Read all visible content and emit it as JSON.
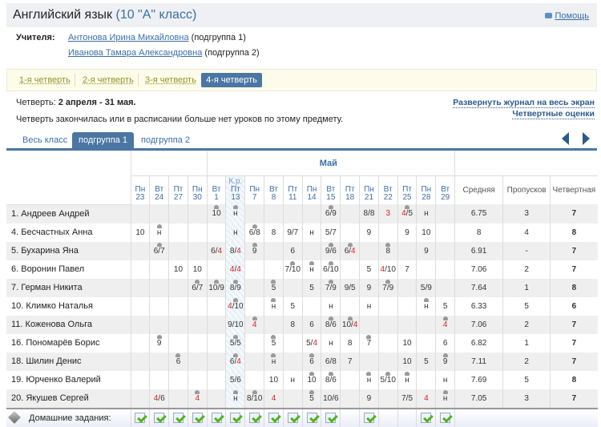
{
  "header": {
    "subject": "Английский язык",
    "class_label": "(10 \"А\" класс)",
    "help": "Помощь"
  },
  "teachers": {
    "label": "Учителя:",
    "list": [
      {
        "name": "Антонова Ирина Михайловна",
        "group": "(подгруппа 1)"
      },
      {
        "name": "Иванова Тамара Александровна",
        "group": "(подгруппа 2)"
      }
    ]
  },
  "quarters": [
    "1-я четверть",
    "2-я четверть",
    "3-я четверть",
    "4-я четверть"
  ],
  "period": {
    "label": "Четверть:",
    "value": "2 апреля - 31 мая.",
    "message": "Четверть закончилась или в расписании больше нет уроков по этому предмету."
  },
  "links": {
    "expand": "Развернуть журнал на весь экран",
    "quarter_marks": "Четвертные оценки"
  },
  "tabs": [
    "Весь класс",
    "подгруппа 1",
    "подгруппа 2"
  ],
  "journal": {
    "month": "Май",
    "days": [
      {
        "d": "Пн",
        "n": "23"
      },
      {
        "d": "Вт",
        "n": "24"
      },
      {
        "d": "Пт",
        "n": "27"
      },
      {
        "d": "Пн",
        "n": "30"
      },
      {
        "d": "Вт",
        "n": "1"
      },
      {
        "d": "Пт",
        "n": "13",
        "tag": "К.р."
      },
      {
        "d": "Пн",
        "n": "7"
      },
      {
        "d": "Вт",
        "n": "8"
      },
      {
        "d": "Пт",
        "n": "11"
      },
      {
        "d": "Пн",
        "n": "14"
      },
      {
        "d": "Вт",
        "n": "15"
      },
      {
        "d": "Пт",
        "n": "18"
      },
      {
        "d": "Пн",
        "n": "21"
      },
      {
        "d": "Вт",
        "n": "22"
      },
      {
        "d": "Пт",
        "n": "25"
      },
      {
        "d": "Пн",
        "n": "28"
      },
      {
        "d": "Вт",
        "n": "29"
      }
    ],
    "summary_headers": [
      "Средняя",
      "Пропусков",
      "Четвертная"
    ],
    "students": [
      {
        "name": "1. Андреев Андрей",
        "marks": [
          "",
          "",
          "",
          "",
          "10^",
          "н^",
          "",
          "",
          "",
          "",
          "6/9^",
          "",
          "8/8",
          "3",
          "4/5^",
          "н",
          ""
        ],
        "avg": "6.75",
        "absences": "3",
        "final": "7"
      },
      {
        "name": "4. Бесчастных Анна",
        "marks": [
          "10",
          "н^",
          "",
          "",
          "",
          "н",
          "6/8^",
          "8",
          "9/7",
          "н",
          "5/7",
          "",
          "9",
          "",
          "9",
          "10",
          ""
        ],
        "avg": "8",
        "absences": "4",
        "final": "8"
      },
      {
        "name": "5. Бухарина Яна",
        "marks": [
          "",
          "6/7^",
          "",
          "",
          "6/4",
          "8/4",
          "9^",
          "",
          "6",
          "",
          "9/6^",
          "6/4^",
          "",
          "8^",
          "",
          "9",
          ""
        ],
        "avg": "6.91",
        "absences": "-",
        "final": "7"
      },
      {
        "name": "6. Воронин Павел",
        "marks": [
          "",
          "",
          "10",
          "10",
          "",
          "4/4",
          "",
          "",
          "7/10^",
          "н^",
          "6/10^",
          "",
          "5",
          "4/10",
          "7",
          "",
          ""
        ],
        "avg": "7.06",
        "absences": "2",
        "final": "7"
      },
      {
        "name": "7. Герман Никита",
        "marks": [
          "",
          "",
          "",
          "6/7^",
          "10/9^",
          "8/9^",
          "",
          "5^",
          "",
          "5",
          "7/9^",
          "9/5",
          "9",
          "7/9^",
          "",
          "5/9",
          ""
        ],
        "avg": "7.64",
        "absences": "1",
        "final": "8"
      },
      {
        "name": "10. Климко Наталья",
        "marks": [
          "",
          "",
          "",
          "",
          "",
          "4/10^",
          "",
          "н^",
          "5",
          "",
          "н",
          "",
          "н",
          "",
          "",
          "н^",
          "5"
        ],
        "avg": "6.33",
        "absences": "5",
        "final": "6"
      },
      {
        "name": "11. Коженова Ольга",
        "marks": [
          "",
          "",
          "",
          "",
          "",
          "9/10",
          "4^",
          "",
          "8",
          "6",
          "8/6^",
          "10/4^",
          "",
          "",
          "",
          "",
          "4^"
        ],
        "avg": "7.06",
        "absences": "2",
        "final": "7"
      },
      {
        "name": "16. Пономарёв Борис",
        "marks": [
          "",
          "9^",
          "",
          "",
          "",
          "5/5^",
          "",
          "5^",
          "",
          "5/4",
          "н",
          "8",
          "7^",
          "",
          "10",
          "",
          "6"
        ],
        "avg": "6.82",
        "absences": "1",
        "final": "7"
      },
      {
        "name": "18. Шилин Денис",
        "marks": [
          "",
          "",
          "6^",
          "",
          "",
          "6/4^",
          "",
          "н^",
          "",
          "6^",
          "6/8",
          "7",
          "",
          "",
          "10",
          "5",
          "9^"
        ],
        "avg": "7.11",
        "absences": "2",
        "final": "7"
      },
      {
        "name": "19. Юрченко Валерий",
        "marks": [
          "",
          "",
          "",
          "",
          "",
          "5/6",
          "",
          "10",
          "н",
          "10^",
          "8/6^",
          "",
          "н^",
          "5/10^",
          "н^",
          "",
          "н"
        ],
        "avg": "7.69",
        "absences": "5",
        "final": "8"
      },
      {
        "name": "20. Якушев Сергей",
        "marks": [
          "",
          "4/6",
          "",
          "4^",
          "",
          "н^",
          "8/10^",
          "4",
          "",
          "5^",
          "10/6",
          "",
          "9",
          "",
          "7/5",
          "4",
          "н^"
        ],
        "avg": "7.05",
        "absences": "3",
        "final": "7"
      }
    ],
    "homework_label": "Домашние задания:",
    "homework": [
      true,
      true,
      true,
      true,
      true,
      true,
      true,
      true,
      true,
      true,
      true,
      false,
      true,
      false,
      false,
      true,
      true
    ]
  },
  "colors": {
    "accent": "#4b76a3",
    "link": "#3a6ea5",
    "low_mark": "#dd2222"
  }
}
